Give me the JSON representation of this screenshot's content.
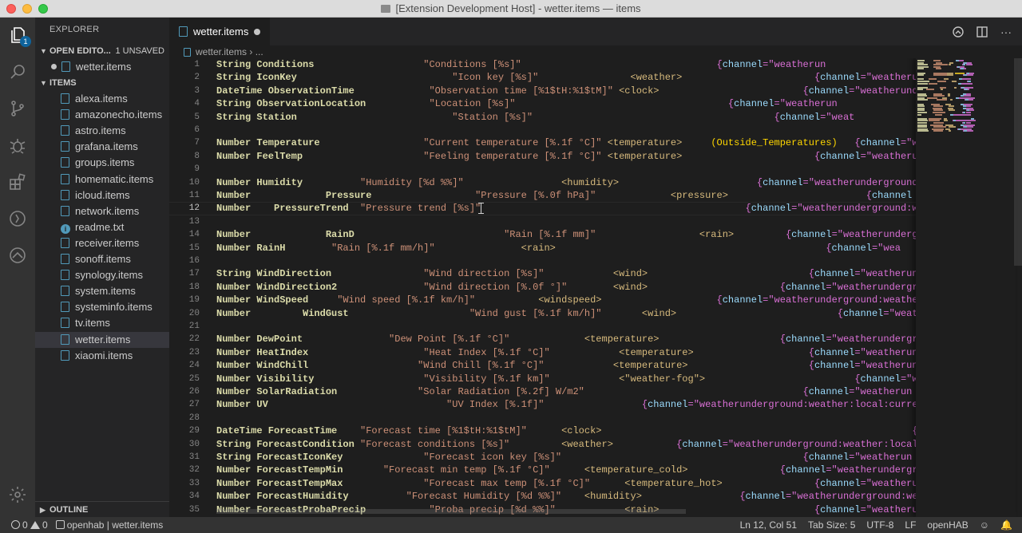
{
  "window": {
    "title": "[Extension Development Host] - wetter.items — items"
  },
  "activity": {
    "explorer_badge": "1"
  },
  "sidebar": {
    "title": "EXPLORER",
    "open_editors": {
      "label": "OPEN EDITO...",
      "unsaved": "1 UNSAVED",
      "items": [
        "wetter.items"
      ]
    },
    "folder": {
      "label": "ITEMS"
    },
    "files": [
      "alexa.items",
      "amazonecho.items",
      "astro.items",
      "grafana.items",
      "groups.items",
      "homematic.items",
      "icloud.items",
      "network.items",
      "readme.txt",
      "receiver.items",
      "sonoff.items",
      "synology.items",
      "system.items",
      "systeminfo.items",
      "tv.items",
      "wetter.items",
      "xiaomi.items"
    ],
    "selected": "wetter.items",
    "outline": "OUTLINE"
  },
  "tab": {
    "label": "wetter.items"
  },
  "breadcrumb": {
    "file": "wetter.items",
    "more": "..."
  },
  "editor": {
    "current_line": 12,
    "lines": [
      [
        1,
        [
          [
            "kw",
            "String Conditions                   "
          ],
          [
            "str",
            "\"Conditions [%s]\"                                  "
          ],
          [
            "br",
            "{"
          ],
          [
            "chk",
            "channel"
          ],
          [
            "br",
            "=\"weatherun"
          ]
        ]
      ],
      [
        2,
        [
          [
            "kw",
            "String IconKey                           "
          ],
          [
            "str",
            "\"Icon key [%s]\"                "
          ],
          [
            "tag",
            "<weather>                       "
          ],
          [
            "br",
            "{"
          ],
          [
            "chk",
            "channel"
          ],
          [
            "br",
            "=\"weatherun"
          ]
        ]
      ],
      [
        3,
        [
          [
            "kw",
            "DateTime ObservationTime             "
          ],
          [
            "str",
            "\"Observation time [%1$tH:%1$tM]\" "
          ],
          [
            "tag",
            "<clock>                         "
          ],
          [
            "br",
            "{"
          ],
          [
            "chk",
            "channel"
          ],
          [
            "br",
            "=\"weatherundergr"
          ]
        ]
      ],
      [
        4,
        [
          [
            "kw",
            "String ObservationLocation           "
          ],
          [
            "str",
            "\"Location [%s]\"                                     "
          ],
          [
            "br",
            "{"
          ],
          [
            "chk",
            "channel"
          ],
          [
            "br",
            "=\"weatherun"
          ]
        ]
      ],
      [
        5,
        [
          [
            "kw",
            "String Station                           "
          ],
          [
            "str",
            "\"Station [%s]\"                                          "
          ],
          [
            "br",
            "{"
          ],
          [
            "chk",
            "channel"
          ],
          [
            "br",
            "=\"weat"
          ]
        ]
      ],
      [
        6,
        []
      ],
      [
        7,
        [
          [
            "kw",
            "Number Temperature                  "
          ],
          [
            "str",
            "\"Current temperature [%.1f °C]\" "
          ],
          [
            "tag",
            "<temperature>     "
          ],
          [
            "grp",
            "(Outside_Temperatures)   "
          ],
          [
            "br",
            "{"
          ],
          [
            "chk",
            "channel"
          ],
          [
            "br",
            "=\"weatherun"
          ]
        ]
      ],
      [
        8,
        [
          [
            "kw",
            "Number FeelTemp                     "
          ],
          [
            "str",
            "\"Feeling temperature [%.1f °C]\" "
          ],
          [
            "tag",
            "<temperature>                       "
          ],
          [
            "br",
            "{"
          ],
          [
            "chk",
            "channel"
          ],
          [
            "br",
            "=\"weatherundergr"
          ]
        ]
      ],
      [
        9,
        []
      ],
      [
        10,
        [
          [
            "kw",
            "Number Humidity          "
          ],
          [
            "str",
            "\"Humidity [%d %%]\"                 "
          ],
          [
            "tag",
            "<humidity>                        "
          ],
          [
            "br",
            "{"
          ],
          [
            "chk",
            "channel"
          ],
          [
            "br",
            "=\"weatherunderground"
          ]
        ]
      ],
      [
        11,
        [
          [
            "kw",
            "Number             Pressure                  "
          ],
          [
            "str",
            "\"Pressure [%.0f hPa]\"             "
          ],
          [
            "tag",
            "<pressure>                        "
          ],
          [
            "br",
            "{"
          ],
          [
            "chk",
            "channel"
          ]
        ]
      ],
      [
        12,
        [
          [
            "kw",
            "Number    PressureTrend  "
          ],
          [
            "str",
            "\"Pressure trend [%s]\"                                              "
          ],
          [
            "br",
            "{"
          ],
          [
            "chk",
            "channel"
          ],
          [
            "br",
            "=\"weatherunderground:weat"
          ]
        ]
      ],
      [
        13,
        []
      ],
      [
        14,
        [
          [
            "kw",
            "Number             RainD                          "
          ],
          [
            "str",
            "\"Rain [%.1f mm]\"                  "
          ],
          [
            "tag",
            "<rain>         "
          ],
          [
            "br",
            "{"
          ],
          [
            "chk",
            "channel"
          ],
          [
            "br",
            "=\"weatherunderground"
          ]
        ]
      ],
      [
        15,
        [
          [
            "kw",
            "Number RainH        "
          ],
          [
            "str",
            "\"Rain [%.1f mm/h]\"               "
          ],
          [
            "tag",
            "<rain>                                               "
          ],
          [
            "br",
            "{"
          ],
          [
            "chk",
            "channel"
          ],
          [
            "br",
            "=\"wea"
          ]
        ]
      ],
      [
        16,
        []
      ],
      [
        17,
        [
          [
            "kw",
            "String WindDirection                "
          ],
          [
            "str",
            "\"Wind direction [%s]\"            "
          ],
          [
            "tag",
            "<wind>                            "
          ],
          [
            "br",
            "{"
          ],
          [
            "chk",
            "channel"
          ],
          [
            "br",
            "=\"weatherun"
          ]
        ]
      ],
      [
        18,
        [
          [
            "kw",
            "Number WindDirection2               "
          ],
          [
            "str",
            "\"Wind direction [%.0f °]\"        "
          ],
          [
            "tag",
            "<wind>                       "
          ],
          [
            "br",
            "{"
          ],
          [
            "chk",
            "channel"
          ],
          [
            "br",
            "=\"weatherundergr"
          ]
        ]
      ],
      [
        19,
        [
          [
            "kw",
            "Number WindSpeed     "
          ],
          [
            "str",
            "\"Wind speed [%.1f km/h]\"           "
          ],
          [
            "tag",
            "<windspeed>                    "
          ],
          [
            "br",
            "{"
          ],
          [
            "chk",
            "channel"
          ],
          [
            "br",
            "=\"weatherunderground:weather:local:"
          ]
        ]
      ],
      [
        20,
        [
          [
            "kw",
            "Number         WindGust                     "
          ],
          [
            "str",
            "\"Wind gust [%.1f km/h]\"       "
          ],
          [
            "tag",
            "<wind>                            "
          ],
          [
            "br",
            "{"
          ],
          [
            "chk",
            "channel"
          ],
          [
            "br",
            "=\"weatherun"
          ]
        ]
      ],
      [
        21,
        []
      ],
      [
        22,
        [
          [
            "kw",
            "Number DewPoint               "
          ],
          [
            "str",
            "\"Dew Point [%.1f °C]\"             "
          ],
          [
            "tag",
            "<temperature>                     "
          ],
          [
            "br",
            "{"
          ],
          [
            "chk",
            "channel"
          ],
          [
            "br",
            "=\"weatherunderground"
          ]
        ]
      ],
      [
        23,
        [
          [
            "kw",
            "Number HeatIndex                    "
          ],
          [
            "str",
            "\"Heat Index [%.1f °C]\"            "
          ],
          [
            "tag",
            "<temperature>                    "
          ],
          [
            "br",
            "{"
          ],
          [
            "chk",
            "channel"
          ],
          [
            "br",
            "=\"weatherun"
          ]
        ]
      ],
      [
        24,
        [
          [
            "kw",
            "Number WindChill                   "
          ],
          [
            "str",
            "\"Wind Chill [%.1f °C]\"            "
          ],
          [
            "tag",
            "<temperature>                     "
          ],
          [
            "br",
            "{"
          ],
          [
            "chk",
            "channel"
          ],
          [
            "br",
            "=\"weatherundergr"
          ]
        ]
      ],
      [
        25,
        [
          [
            "kw",
            "Number Visibility                   "
          ],
          [
            "str",
            "\"Visibility [%.1f km]\"            "
          ],
          [
            "tag",
            "<\"weather-fog\">                          "
          ],
          [
            "br",
            "{"
          ],
          [
            "chk",
            "channel"
          ],
          [
            "br",
            "=\"weatherun"
          ]
        ]
      ],
      [
        26,
        [
          [
            "kw",
            "Number SolarRadiation              "
          ],
          [
            "str",
            "\"Solar Radiation [%.2f] W/m2\"                                      "
          ],
          [
            "br",
            "{"
          ],
          [
            "chk",
            "channel"
          ],
          [
            "br",
            "=\"weatherun"
          ]
        ]
      ],
      [
        27,
        [
          [
            "kw",
            "Number UV                               "
          ],
          [
            "str",
            "\"UV Index [%.1f]\"                 "
          ],
          [
            "br",
            "{"
          ],
          [
            "chk",
            "channel"
          ],
          [
            "br",
            "=\"weatherunderground:weather:local:curre"
          ]
        ]
      ],
      [
        28,
        []
      ],
      [
        29,
        [
          [
            "kw",
            "DateTime ForecastTime    "
          ],
          [
            "str",
            "\"Forecast time [%1$tH:%1$tM]\"      "
          ],
          [
            "tag",
            "<clock>                                                      "
          ],
          [
            "br",
            "{"
          ],
          [
            "chk",
            "channel"
          ]
        ]
      ],
      [
        30,
        [
          [
            "kw",
            "String ForecastCondition "
          ],
          [
            "str",
            "\"Forecast conditions [%s]\"         "
          ],
          [
            "tag",
            "<weather>           "
          ],
          [
            "br",
            "{"
          ],
          [
            "chk",
            "channel"
          ],
          [
            "br",
            "=\"weatherunderground:weather:local:forecastTo"
          ]
        ]
      ],
      [
        31,
        [
          [
            "kw",
            "String ForecastIconKey              "
          ],
          [
            "str",
            "\"Forecast icon key [%s]\"                                          "
          ],
          [
            "br",
            "{"
          ],
          [
            "chk",
            "channel"
          ],
          [
            "br",
            "=\"weatherun"
          ]
        ]
      ],
      [
        32,
        [
          [
            "kw",
            "Number ForecastTempMin       "
          ],
          [
            "str",
            "\"Forecast min temp [%.1f °C]\"      "
          ],
          [
            "tag",
            "<temperature_cold>                "
          ],
          [
            "br",
            "{"
          ],
          [
            "chk",
            "channel"
          ],
          [
            "br",
            "=\"weatherunderground:weat"
          ]
        ]
      ],
      [
        33,
        [
          [
            "kw",
            "Number ForecastTempMax              "
          ],
          [
            "str",
            "\"Forecast max temp [%.1f °C]\"      "
          ],
          [
            "tag",
            "<temperature_hot>                "
          ],
          [
            "br",
            "{"
          ],
          [
            "chk",
            "channel"
          ],
          [
            "br",
            "=\"weatherundergr"
          ]
        ]
      ],
      [
        34,
        [
          [
            "kw",
            "Number ForecastHumidity          "
          ],
          [
            "str",
            "\"Forecast Humidity [%d %%]\"    "
          ],
          [
            "tag",
            "<humidity>                 "
          ],
          [
            "br",
            "{"
          ],
          [
            "chk",
            "channel"
          ],
          [
            "br",
            "=\"weatherunderground:weat"
          ]
        ]
      ],
      [
        35,
        [
          [
            "kw",
            "Number ForecastProbaPrecip           "
          ],
          [
            "str",
            "\"Proba precip [%d %%]\"            "
          ],
          [
            "tag",
            "<rain>                           "
          ],
          [
            "br",
            "{"
          ],
          [
            "chk",
            "channel"
          ],
          [
            "br",
            "=\"weatherundergr"
          ]
        ]
      ]
    ]
  },
  "statusbar": {
    "errors": "0",
    "warnings": "0",
    "workspace": "openhab | wetter.items",
    "position": "Ln 12, Col 51",
    "tab_size": "Tab Size: 5",
    "encoding": "UTF-8",
    "eol": "LF",
    "language": "openHAB"
  }
}
